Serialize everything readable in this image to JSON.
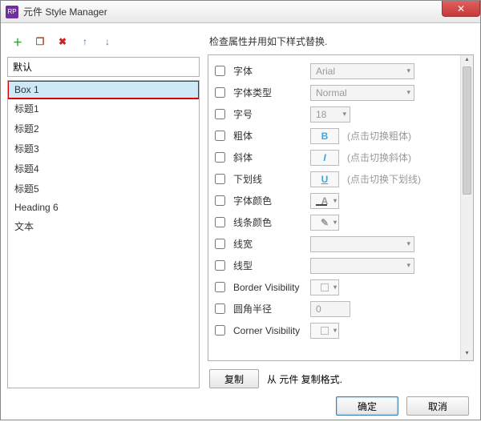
{
  "window": {
    "title": "元件 Style Manager",
    "app_icon_text": "RP"
  },
  "toolbar_icons": {
    "add": "＋",
    "copy": "❐",
    "delete": "✖",
    "up": "↑",
    "down": "↓"
  },
  "filter_value": "默认",
  "styles": [
    "Box 1",
    "标题1",
    "标题2",
    "标题3",
    "标题4",
    "标题5",
    "Heading 6",
    "文本"
  ],
  "selected_style_index": 0,
  "right_header": "检查属性并用如下样式替换.",
  "props": {
    "font": {
      "label": "字体",
      "value": "Arial"
    },
    "font_style": {
      "label": "字体类型",
      "value": "Normal"
    },
    "font_size": {
      "label": "字号",
      "value": "18"
    },
    "bold": {
      "label": "粗体",
      "glyph": "B",
      "hint": "(点击切换粗体)"
    },
    "italic": {
      "label": "斜体",
      "glyph": "I",
      "hint": "(点击切换斜体)"
    },
    "underline": {
      "label": "下划线",
      "glyph": "U",
      "hint": "(点击切换下划线)"
    },
    "font_color": {
      "label": "字体颜色",
      "glyph": "A"
    },
    "line_color": {
      "label": "线条颜色"
    },
    "line_width": {
      "label": "线宽"
    },
    "line_style": {
      "label": "线型"
    },
    "border_vis": {
      "label": "Border Visibility"
    },
    "corner_r": {
      "label": "圆角半径",
      "value": "0"
    },
    "corner_vis": {
      "label": "Corner Visibility"
    }
  },
  "copy_row": {
    "btn": "复制",
    "text": "从 元件 复制格式."
  },
  "footer": {
    "ok": "确定",
    "cancel": "取消"
  }
}
